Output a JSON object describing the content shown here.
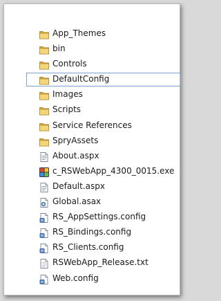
{
  "items": [
    {
      "label": "App_Themes",
      "type": "folder",
      "icon": "folder-icon"
    },
    {
      "label": "bin",
      "type": "folder",
      "icon": "folder-icon"
    },
    {
      "label": "Controls",
      "type": "folder",
      "icon": "folder-icon"
    },
    {
      "label": "DefaultConfig",
      "type": "folder",
      "icon": "folder-icon",
      "selected": true
    },
    {
      "label": "Images",
      "type": "folder",
      "icon": "folder-icon"
    },
    {
      "label": "Scripts",
      "type": "folder",
      "icon": "folder-icon"
    },
    {
      "label": "Service References",
      "type": "folder",
      "icon": "folder-icon"
    },
    {
      "label": "SpryAssets",
      "type": "folder",
      "icon": "folder-icon"
    },
    {
      "label": "About.aspx",
      "type": "aspx",
      "icon": "aspx-file-icon"
    },
    {
      "label": "c_RSWebApp_4300_0015.exe",
      "type": "exe",
      "icon": "exe-file-icon"
    },
    {
      "label": "Default.aspx",
      "type": "aspx",
      "icon": "aspx-file-icon"
    },
    {
      "label": "Global.asax",
      "type": "asax",
      "icon": "asax-file-icon"
    },
    {
      "label": "RS_AppSettings.config",
      "type": "config",
      "icon": "config-file-icon"
    },
    {
      "label": "RS_Bindings.config",
      "type": "config",
      "icon": "config-file-icon"
    },
    {
      "label": "RS_Clients.config",
      "type": "config",
      "icon": "config-file-icon"
    },
    {
      "label": "RSWebApp_Release.txt",
      "type": "txt",
      "icon": "text-file-icon"
    },
    {
      "label": "Web.config",
      "type": "config",
      "icon": "config-file-icon"
    }
  ],
  "colors": {
    "folder": "#e8c25a",
    "selection_border": "#7da2ce"
  }
}
